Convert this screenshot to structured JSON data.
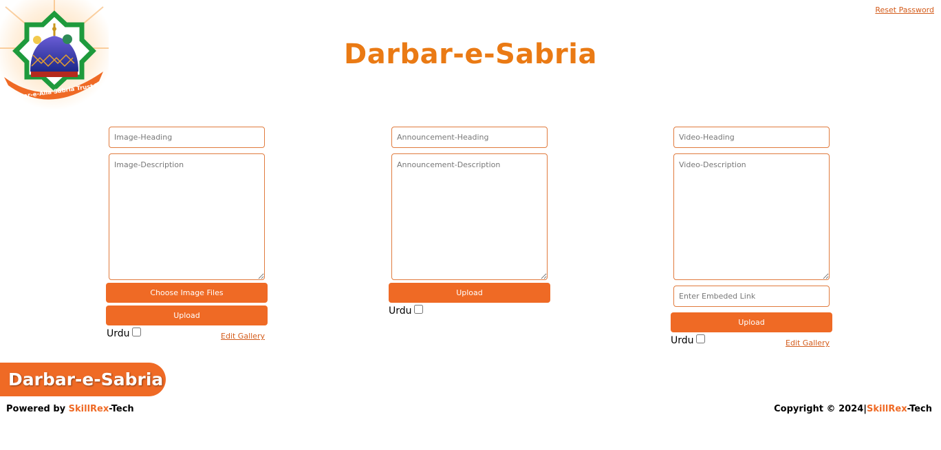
{
  "header": {
    "title": "Darbar-e-Sabria",
    "reset_password": "Reset Password",
    "logo_text": "Darbar-e-Alia Sabria Trust®"
  },
  "image_section": {
    "heading_placeholder": "Image-Heading",
    "description_placeholder": "Image-Description",
    "choose_button": "Choose Image Files",
    "upload_button": "Upload",
    "urdu_label": "Urdu",
    "edit_link": "Edit Gallery"
  },
  "announcement_section": {
    "heading_placeholder": "Announcement-Heading",
    "description_placeholder": "Announcement-Description",
    "upload_button": "Upload",
    "urdu_label": "Urdu"
  },
  "video_section": {
    "heading_placeholder": "Video-Heading",
    "description_placeholder": "Video-Description",
    "link_placeholder": "Enter Embeded Link",
    "upload_button": "Upload",
    "urdu_label": "Urdu",
    "edit_link": "Edit Gallery"
  },
  "footer": {
    "badge": "Darbar-e-Sabria",
    "powered_prefix": "Powered by ",
    "brand_a": "SkillRex",
    "brand_b": "-Tech",
    "copyright_prefix": "Copyright © 2024|"
  },
  "colors": {
    "accent": "#ef6a25",
    "title": "#ea7a14",
    "border": "#e07a3c"
  }
}
